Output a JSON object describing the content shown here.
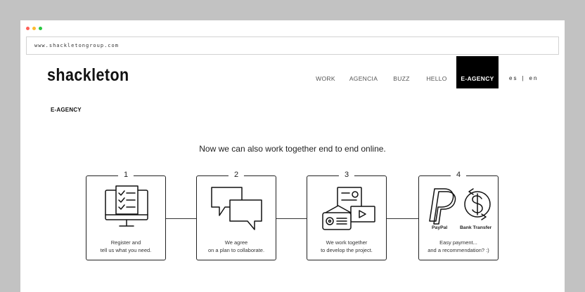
{
  "browser": {
    "url": "www.shackletongroup.com",
    "dot_colors": [
      "#ff5f57",
      "#febc2e",
      "#28c840"
    ]
  },
  "header": {
    "logo": "shackleton",
    "nav": [
      {
        "label": "WORK",
        "active": false
      },
      {
        "label": "AGENCIA",
        "active": false
      },
      {
        "label": "BUZZ",
        "active": false
      },
      {
        "label": "HELLO",
        "active": false
      },
      {
        "label": "E-AGENCY",
        "active": true
      }
    ],
    "languages": [
      "es",
      "|",
      "en"
    ]
  },
  "main": {
    "section_title": "E-AGENCY",
    "intro": "Now we can also work together end to end online.",
    "steps": [
      {
        "number": "1",
        "icon": "checklist-monitor-icon",
        "lines": [
          "Register and",
          "tell us what you need."
        ]
      },
      {
        "number": "2",
        "icon": "chat-bubbles-icon",
        "lines": [
          "We agree",
          "on a plan to collaborate."
        ]
      },
      {
        "number": "3",
        "icon": "media-devices-icon",
        "lines": [
          "We work together",
          "to develop the project."
        ]
      },
      {
        "number": "4",
        "icon": "payment-icons",
        "lines": [
          "Easy payment...",
          "and a recommendation? :)"
        ],
        "icon_labels": [
          "PayPal",
          "Bank Transfer"
        ]
      }
    ]
  },
  "colors": {
    "frame_background": "#c2c2c2",
    "nav_active_bg": "#000000",
    "nav_active_text": "#ffffff"
  }
}
